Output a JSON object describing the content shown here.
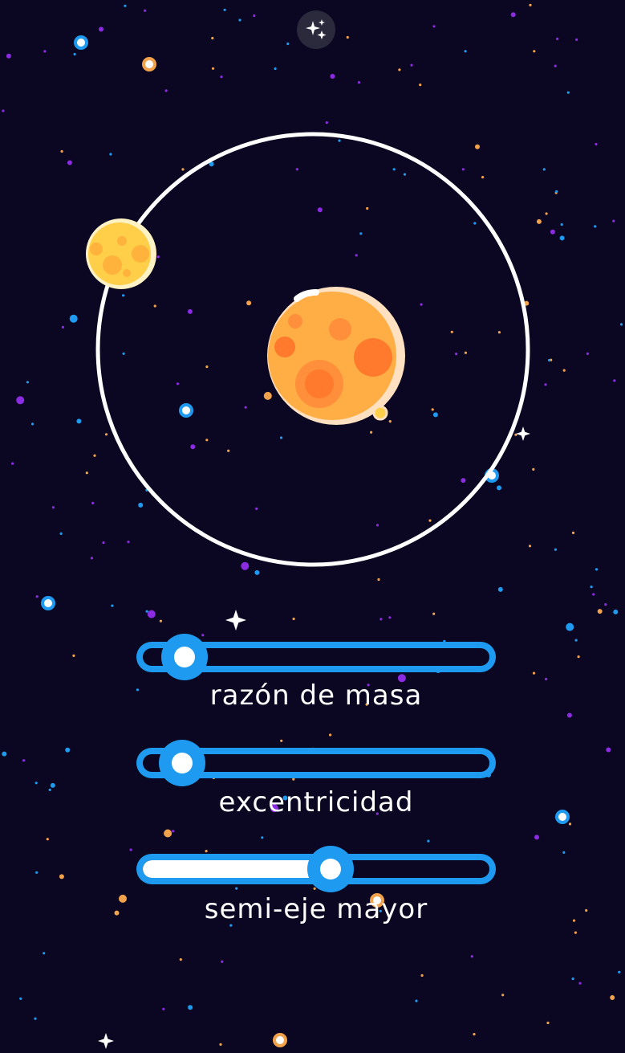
{
  "app": {
    "top_button_icon": "sparkles-icon",
    "colors": {
      "background": "#0b0722",
      "slider_accent": "#1e9bf0",
      "orbit": "#ffffff",
      "star_orange": "#f2a24a",
      "star_purple": "#8b2be2",
      "star_blue": "#1e9bf0",
      "sun": "#ffae45",
      "planet": "#ffcf4a"
    }
  },
  "sliders": [
    {
      "label": "razón de masa",
      "value": 0.05
    },
    {
      "label": "excentricidad",
      "value": 0.04
    },
    {
      "label": "semi-eje mayor",
      "value": 0.55
    }
  ]
}
